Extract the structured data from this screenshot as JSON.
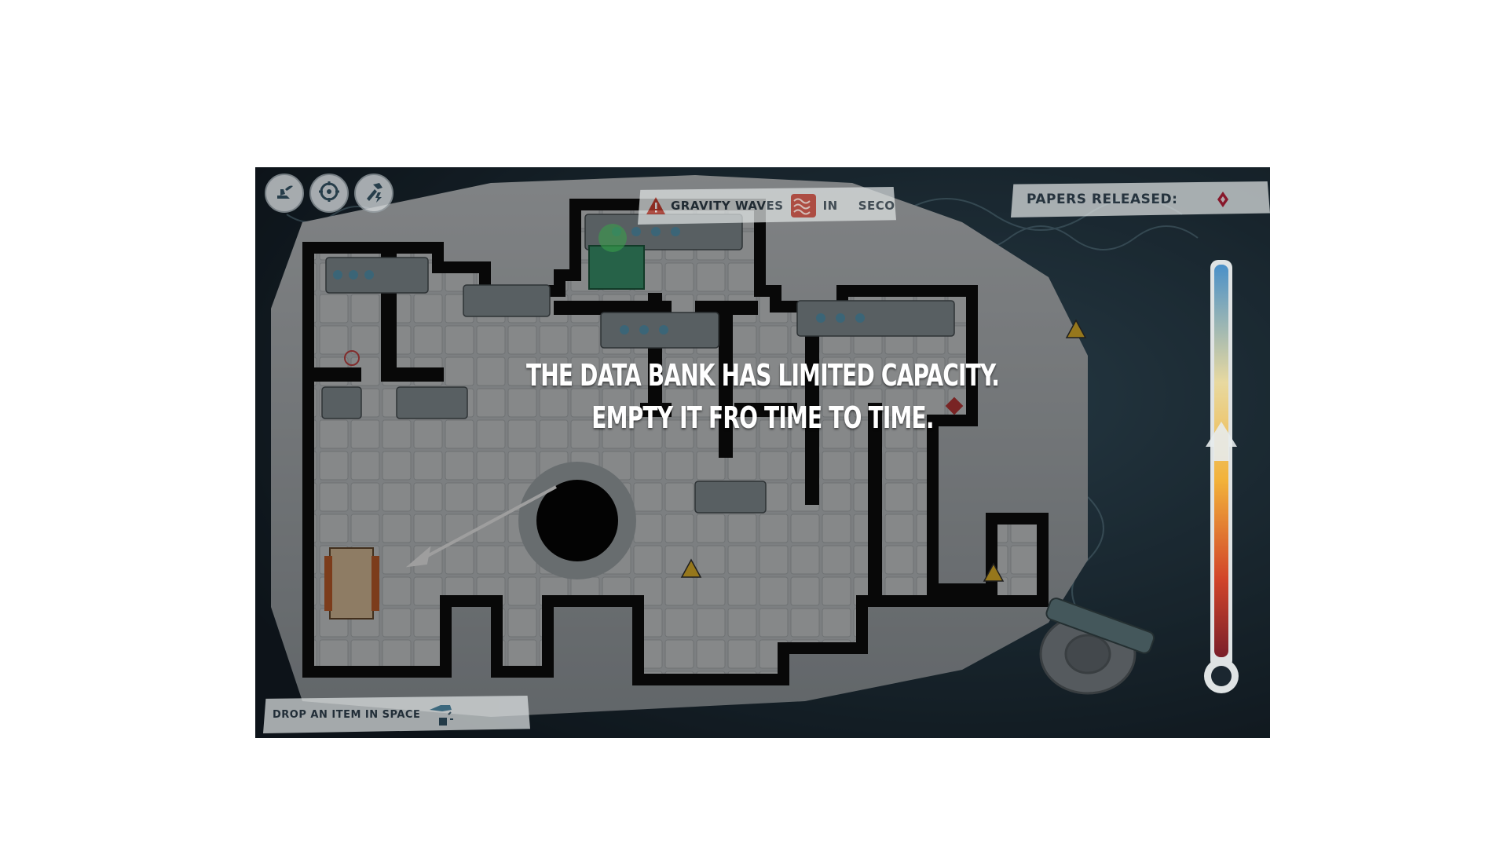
{
  "hud": {
    "buttons": [
      {
        "name": "winged-boot-icon"
      },
      {
        "name": "target-gear-icon"
      },
      {
        "name": "hammer-lightning-icon"
      }
    ],
    "gravity_banner": {
      "label": "GRAVITY WAVES",
      "in_text": "IN",
      "seconds_text": "SECONDS",
      "warning_icon": "warning-icon",
      "wave_icon": "gravity-wave-icon",
      "warning_color": "#c0392b"
    },
    "papers_banner": {
      "label": "PAPERS RELEASED:",
      "icon": "red-diamond-icon",
      "icon_color": "#b3122a"
    },
    "drop_banner": {
      "label": "DROP AN ITEM IN SPACE",
      "icon": "hand-drop-icon"
    }
  },
  "tutorial": {
    "line1": "THE DATA BANK HAS LIMITED CAPACITY.",
    "line2": "EMPTY IT FRO TIME TO TIME."
  },
  "gauge": {
    "colors": [
      "#4a90c8",
      "#e8d9a0",
      "#f2b23a",
      "#d2452a",
      "#7a1f2a"
    ],
    "level": 0.55
  }
}
